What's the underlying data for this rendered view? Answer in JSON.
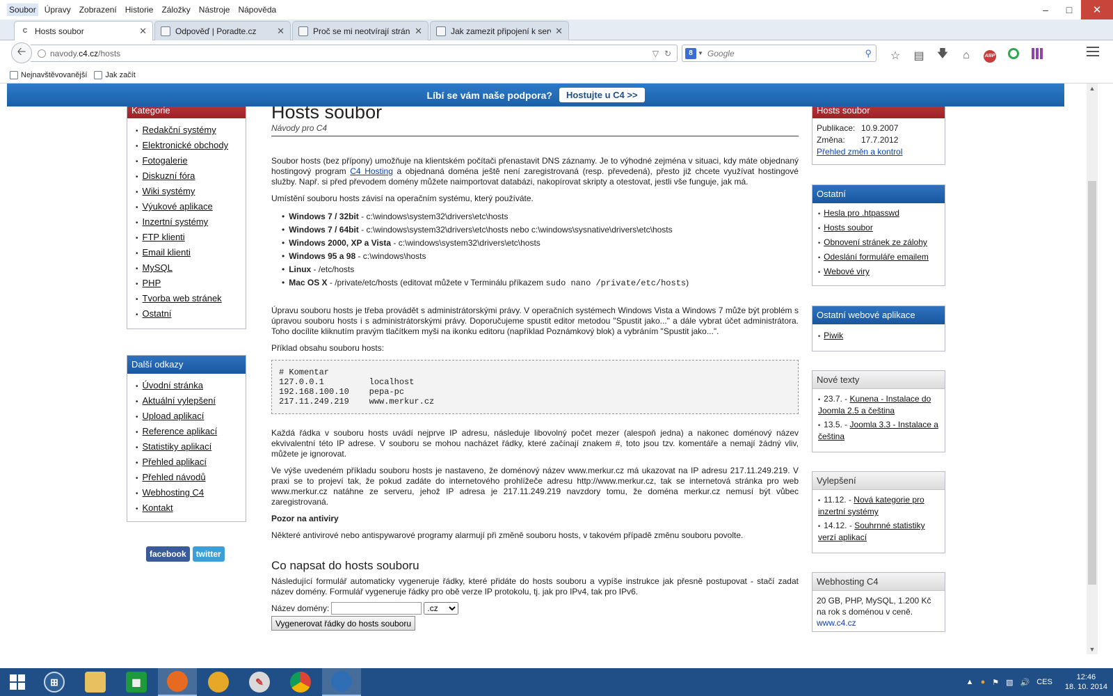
{
  "menubar": [
    "Soubor",
    "Úpravy",
    "Zobrazení",
    "Historie",
    "Záložky",
    "Nástroje",
    "Nápověda"
  ],
  "tabs": [
    {
      "label": "Hosts soubor",
      "icon": "c4-favicon"
    },
    {
      "label": "Odpověď | Poradte.cz",
      "icon": "page-favicon"
    },
    {
      "label": "Proč se mi neotvírají stránk...",
      "icon": "page-favicon"
    },
    {
      "label": "Jak zamezit připojení k serv...",
      "icon": "page-favicon"
    }
  ],
  "nav": {
    "url_prefix": "navody.",
    "url_domain": "c4.cz",
    "url_path": "/hosts",
    "search_placeholder": "Google",
    "search_engine_letter": "8"
  },
  "bookmarks": [
    "Nejnavštěvovanější",
    "Jak začít"
  ],
  "promo": {
    "text": "Líbí se vám naše podpora?",
    "button": "Hostujte u C4 >>"
  },
  "left": {
    "kategorie_title": "Kategorie",
    "kategorie": [
      "Redakční systémy",
      "Elektronické obchody",
      "Fotogalerie",
      "Diskuzní fóra",
      "Wiki systémy",
      "Výukové aplikace",
      "Inzertní systémy",
      "FTP klienti",
      "Email klienti",
      "MySQL",
      "PHP",
      "Tvorba web stránek",
      "Ostatní"
    ],
    "dalsi_title": "Další odkazy",
    "dalsi": [
      "Úvodní stránka",
      "Aktuální vylepšení",
      "Upload aplikací",
      "Reference aplikací",
      "Statistiky aplikací",
      "Přehled aplikací",
      "Přehled návodů",
      "Webhosting C4",
      "Kontakt"
    ],
    "facebook": "facebook",
    "twitter": "twitter"
  },
  "main": {
    "title": "Hosts soubor",
    "subtitle": "Návody pro C4",
    "intro_1": "Soubor hosts (bez přípony) umožňuje na klientském počítači přenastavit DNS záznamy. Je to výhodné zejména v situaci, kdy máte objednaný hostingový program ",
    "intro_link": "C4 Hosting",
    "intro_2": " a objednaná doména ještě není zaregistrovaná (resp. převedená), přesto již chcete využívat hostingové služby. Např. si před převodem domény můžete naimportovat databázi, nakopírovat skripty a otestovat, jestli vše funguje, jak má.",
    "location_intro": "Umístění souboru hosts závisí na operačním systému, který používáte.",
    "os_list": [
      {
        "os": "Windows 7 / 32bit",
        "path": " - c:\\windows\\system32\\drivers\\etc\\hosts"
      },
      {
        "os": "Windows 7 / 64bit",
        "path": " - c:\\windows\\system32\\drivers\\etc\\hosts nebo c:\\windows\\sysnative\\drivers\\etc\\hosts"
      },
      {
        "os": "Windows 2000, XP a Vista",
        "path": " - c:\\windows\\system32\\drivers\\etc\\hosts"
      },
      {
        "os": "Windows 95 a 98",
        "path": " - c:\\windows\\hosts"
      },
      {
        "os": "Linux",
        "path": " - /etc/hosts"
      },
      {
        "os": "Mac OS X",
        "path": " - /private/etc/hosts (editovat můžete v Terminálu příkazem "
      }
    ],
    "mac_cmd": "sudo nano /private/etc/hosts",
    "mac_tail": ")",
    "admin_text": "Úpravu souboru hosts je třeba provádět s administrátorskými právy. V operačních systémech Windows Vista a Windows 7 může být problém s úpravou souboru hosts i s administrátorskými právy. Doporučujeme spustit editor metodou \"Spustit jako...\" a dále vybrat účet administrátora. Toho docílíte kliknutím pravým tlačítkem myši na ikonku editoru (například Poznámkový blok) a vybráním \"Spustit jako...\".",
    "example_intro": "Příklad obsahu souboru hosts:",
    "code": "# Komentar\n127.0.0.1         localhost\n192.168.100.10    pepa-pc\n217.11.249.219    www.merkur.cz",
    "each_line": "Každá řádka v souboru hosts uvádí nejprve IP adresu, následuje libovolný počet mezer (alespoň jedna) a nakonec doménový název ekvivalentní této IP adrese. V souboru se mohou nacházet řádky, které začínají znakem #, toto jsou tzv. komentáře a nemají žádný vliv, můžete je ignorovat.",
    "example_explain": "Ve výše uvedeném příkladu souboru hosts je nastaveno, že doménový název www.merkur.cz má ukazovat na IP adresu 217.11.249.219. V praxi se to projeví tak, že pokud zadáte do internetového prohlížeče adresu http://www.merkur.cz, tak se internetová stránka pro web www.merkur.cz natáhne ze serveru, jehož IP adresa je 217.11.249.219 navzdory tomu, že doména merkur.cz nemusí být vůbec zaregistrovaná.",
    "av_heading": "Pozor na antiviry",
    "av_text": "Některé antivirové nebo antispywarové programy alarmují při změně souboru hosts, v takovém případě změnu souboru povolte.",
    "form_heading": "Co napsat do hosts souboru",
    "form_text": "Následující formulář automaticky vygeneruje řádky, které přidáte do hosts souboru a vypíše instrukce jak přesně postupovat - stačí zadat název domény. Formulář vygeneruje řádky pro obě verze IP protokolu, tj. jak pro IPv4, tak pro IPv6.",
    "domain_label": "Název domény:",
    "domain_value": "",
    "tld_selected": ".cz",
    "generate_button": "Vygenerovat řádky do hosts souboru"
  },
  "right": {
    "info_title": "Hosts soubor",
    "publikace_label": "Publikace:",
    "publikace": "10.9.2007",
    "zmena_label": "Změna:",
    "zmena": "17.7.2012",
    "changes_link": "Přehled změn a kontrol",
    "ostatni_title": "Ostatní",
    "ostatni": [
      "Hesla pro .htpasswd",
      "Hosts soubor",
      "Obnovení stránek ze zálohy",
      "Odeslání formuláře emailem",
      "Webové viry"
    ],
    "apps_title": "Ostatní webové aplikace",
    "apps": [
      "Piwik"
    ],
    "nove_title": "Nové texty",
    "nove": [
      {
        "date": "23.7. - ",
        "link": "Kunena - Instalace do Joomla 2.5 a čeština"
      },
      {
        "date": "13.5. - ",
        "link": "Joomla 3.3 - Instalace a čeština"
      }
    ],
    "vylepseni_title": "Vylepšení",
    "vylepseni": [
      {
        "date": "11.12. - ",
        "link": "Nová kategorie pro inzertní systémy"
      },
      {
        "date": "14.12. - ",
        "link": "Souhrnné statistiky verzí aplikací"
      }
    ],
    "webhosting_title": "Webhosting C4",
    "webhosting_text": "20 GB, PHP, MySQL, 1.200 Kč na rok s doménou v ceně.",
    "webhosting_link": "www.c4.cz"
  },
  "taskbar": {
    "lang": "CES",
    "time": "12:46",
    "date": "18. 10. 2014"
  },
  "colors": {
    "accent_blue": "#1d5fa8",
    "box_red": "#9e2228",
    "taskbar": "#1f4f86"
  }
}
